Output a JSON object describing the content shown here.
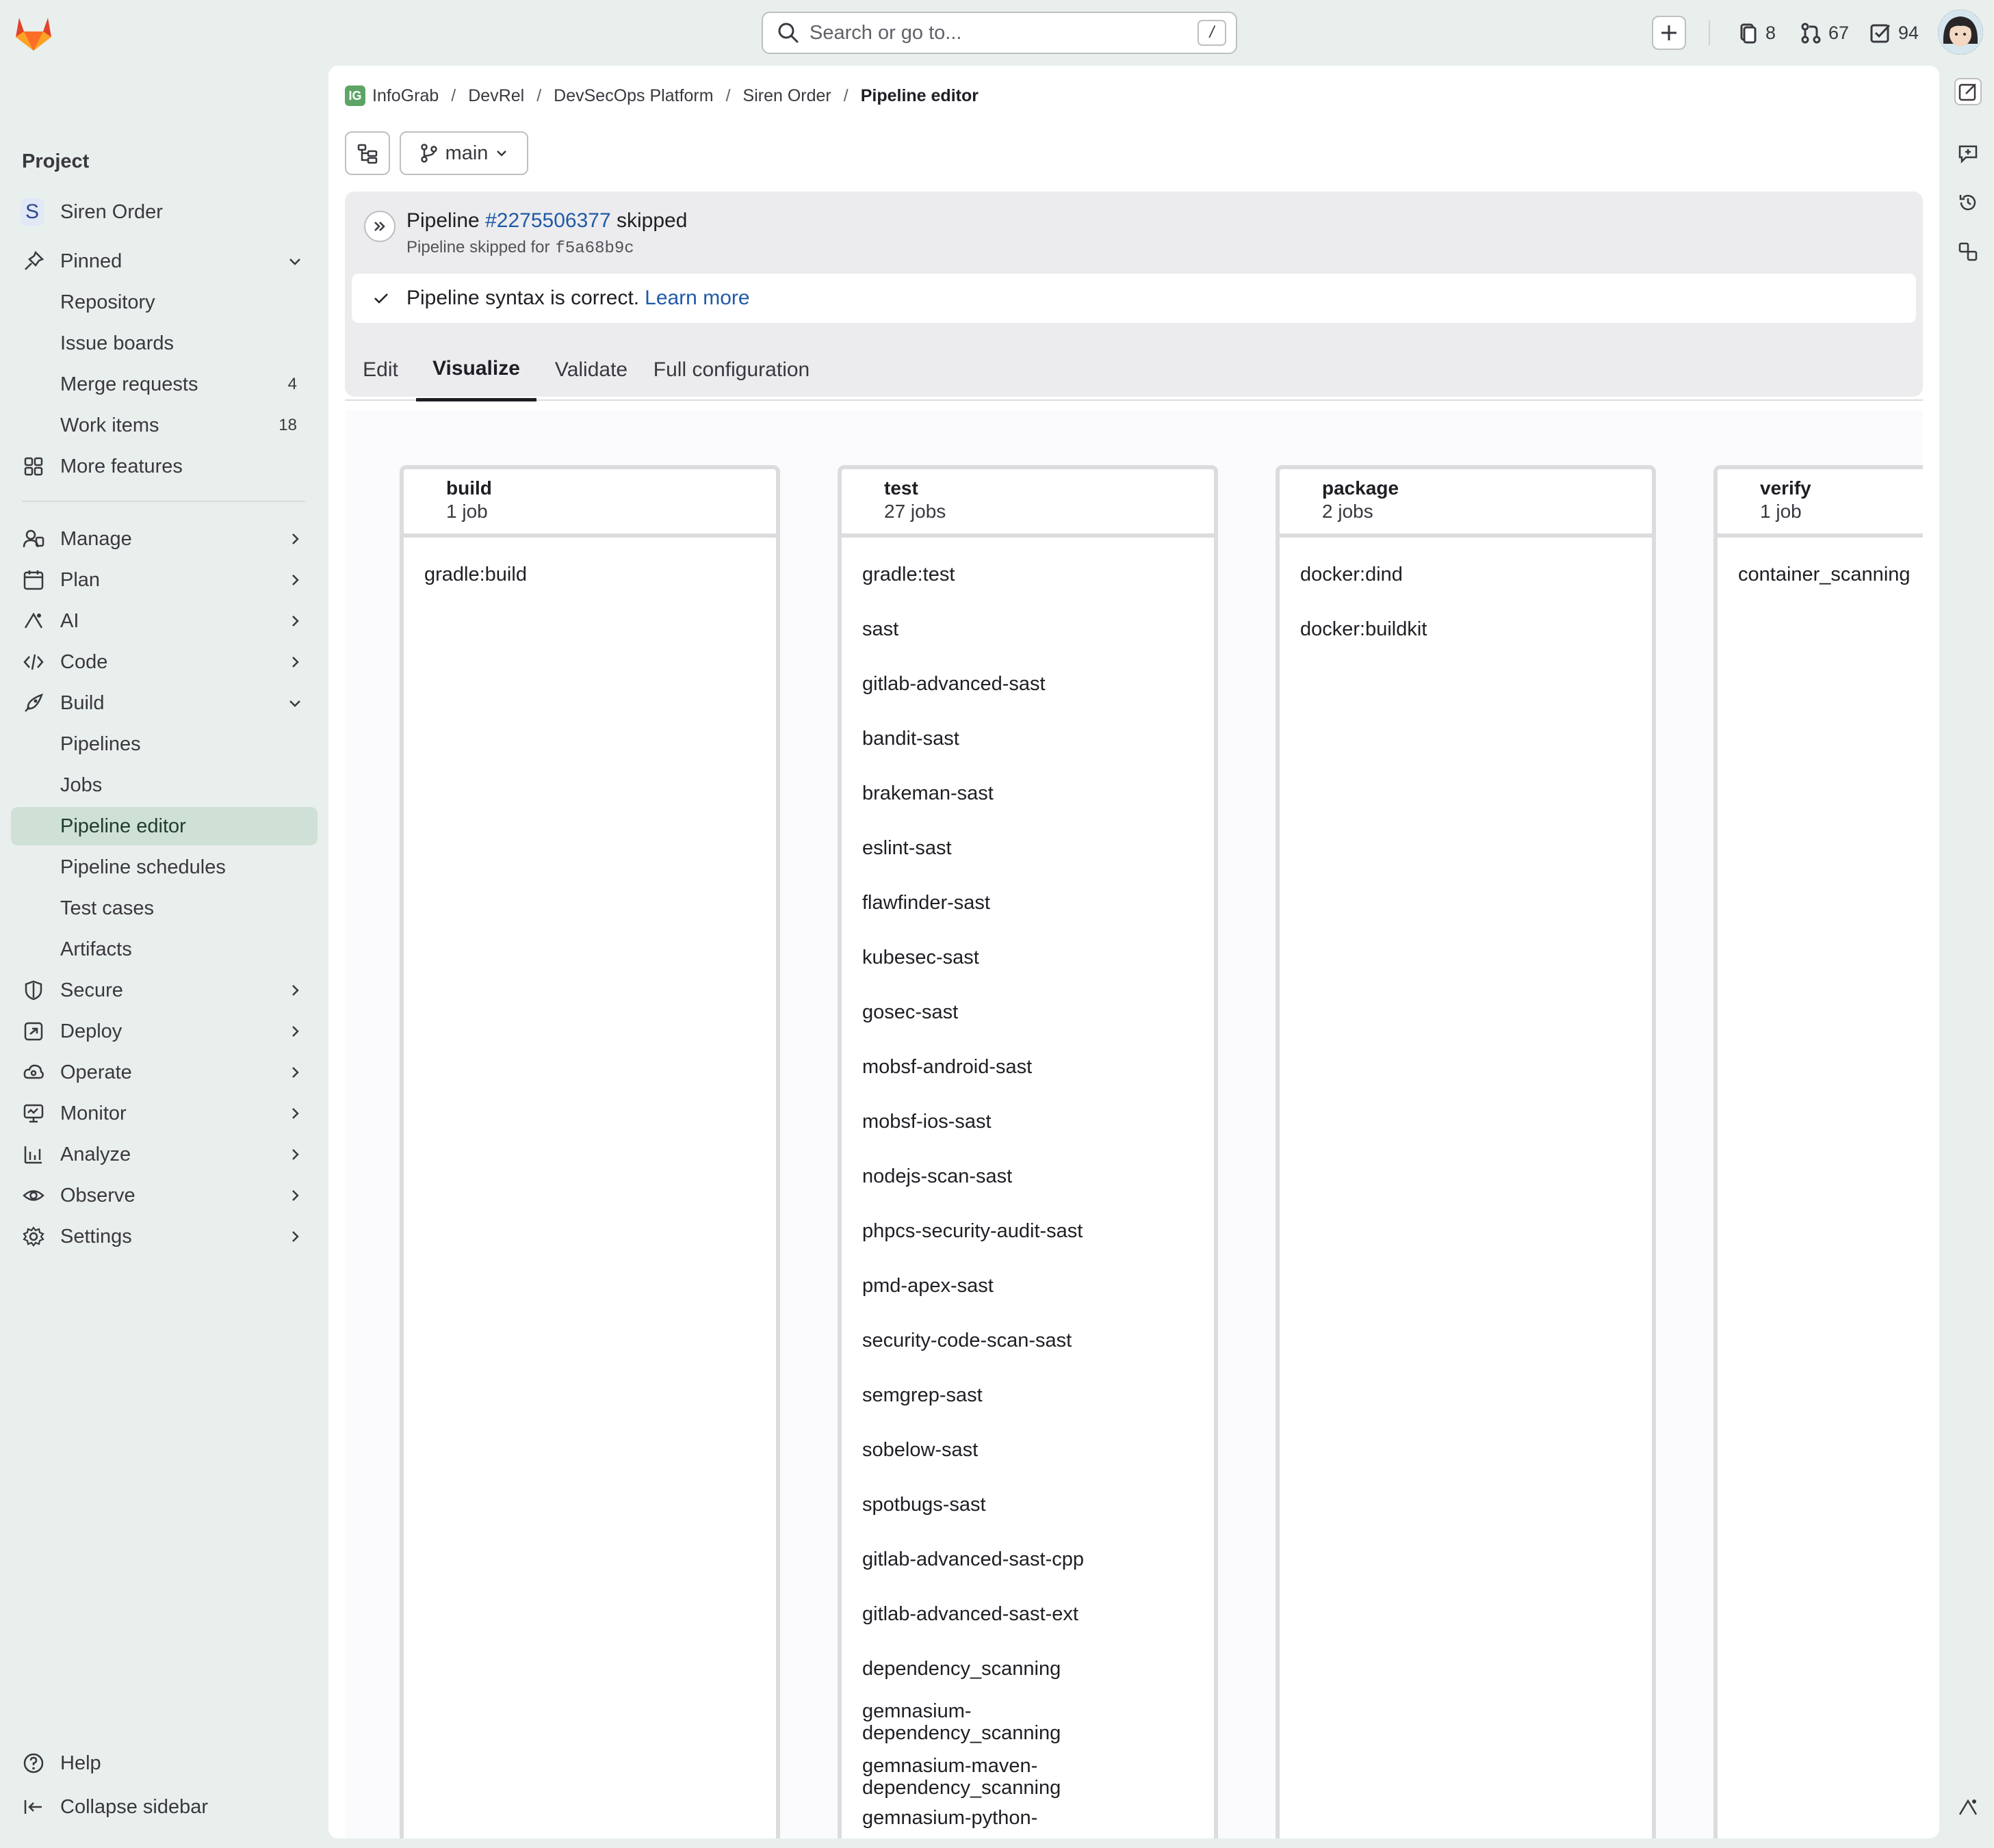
{
  "search": {
    "placeholder": "Search or go to...",
    "shortcut": "/"
  },
  "topbar": {
    "counters": [
      {
        "icon": "issues-icon",
        "value": "8"
      },
      {
        "icon": "merge-request-icon",
        "value": "67"
      },
      {
        "icon": "todo-icon",
        "value": "94"
      }
    ]
  },
  "sidebar": {
    "heading": "Project",
    "project": {
      "initial": "S",
      "name": "Siren Order"
    },
    "pinned": {
      "label": "Pinned",
      "items": [
        {
          "label": "Repository"
        },
        {
          "label": "Issue boards"
        },
        {
          "label": "Merge requests",
          "badge": "4"
        },
        {
          "label": "Work items",
          "badge": "18"
        }
      ]
    },
    "more_features": "More features",
    "sections": [
      {
        "label": "Manage",
        "icon": "manage-icon"
      },
      {
        "label": "Plan",
        "icon": "plan-icon"
      },
      {
        "label": "AI",
        "icon": "ai-icon"
      },
      {
        "label": "Code",
        "icon": "code-icon"
      },
      {
        "label": "Build",
        "icon": "rocket-icon"
      }
    ],
    "build_items": [
      {
        "label": "Pipelines"
      },
      {
        "label": "Jobs"
      },
      {
        "label": "Pipeline editor"
      },
      {
        "label": "Pipeline schedules"
      },
      {
        "label": "Test cases"
      },
      {
        "label": "Artifacts"
      }
    ],
    "sections2": [
      {
        "label": "Secure"
      },
      {
        "label": "Deploy"
      },
      {
        "label": "Operate"
      },
      {
        "label": "Monitor"
      },
      {
        "label": "Analyze"
      },
      {
        "label": "Observe"
      },
      {
        "label": "Settings"
      }
    ],
    "help": "Help",
    "collapse": "Collapse sidebar"
  },
  "breadcrumb": {
    "logo_text": "IG",
    "items": [
      "InfoGrab",
      "DevRel",
      "DevSecOps Platform",
      "Siren Order"
    ],
    "current": "Pipeline editor"
  },
  "branch": {
    "name": "main"
  },
  "pipeline": {
    "label": "Pipeline",
    "id": "#2275506377",
    "status": "skipped",
    "sub_label": "Pipeline skipped for",
    "sha": "f5a68b9c"
  },
  "syntax": {
    "message": "Pipeline syntax is correct.",
    "link": "Learn more"
  },
  "tabs": [
    "Edit",
    "Visualize",
    "Validate",
    "Full configuration"
  ],
  "stages": [
    {
      "name": "build",
      "count": "1 job",
      "jobs": [
        "gradle:build"
      ]
    },
    {
      "name": "test",
      "count": "27 jobs",
      "jobs": [
        "gradle:test",
        "sast",
        "gitlab-advanced-sast",
        "bandit-sast",
        "brakeman-sast",
        "eslint-sast",
        "flawfinder-sast",
        "kubesec-sast",
        "gosec-sast",
        "mobsf-android-sast",
        "mobsf-ios-sast",
        "nodejs-scan-sast",
        "phpcs-security-audit-sast",
        "pmd-apex-sast",
        "security-code-scan-sast",
        "semgrep-sast",
        "sobelow-sast",
        "spotbugs-sast",
        "gitlab-advanced-sast-cpp",
        "gitlab-advanced-sast-ext",
        "dependency_scanning"
      ],
      "wrapped_jobs": [
        [
          "gemnasium-",
          "dependency_scanning"
        ],
        [
          "gemnasium-maven-",
          "dependency_scanning"
        ],
        [
          "gemnasium-python-",
          ""
        ]
      ]
    },
    {
      "name": "package",
      "count": "2 jobs",
      "jobs": [
        "docker:dind",
        "docker:buildkit"
      ]
    },
    {
      "name": "verify",
      "count": "1 job",
      "jobs": [
        "container_scanning"
      ]
    }
  ]
}
